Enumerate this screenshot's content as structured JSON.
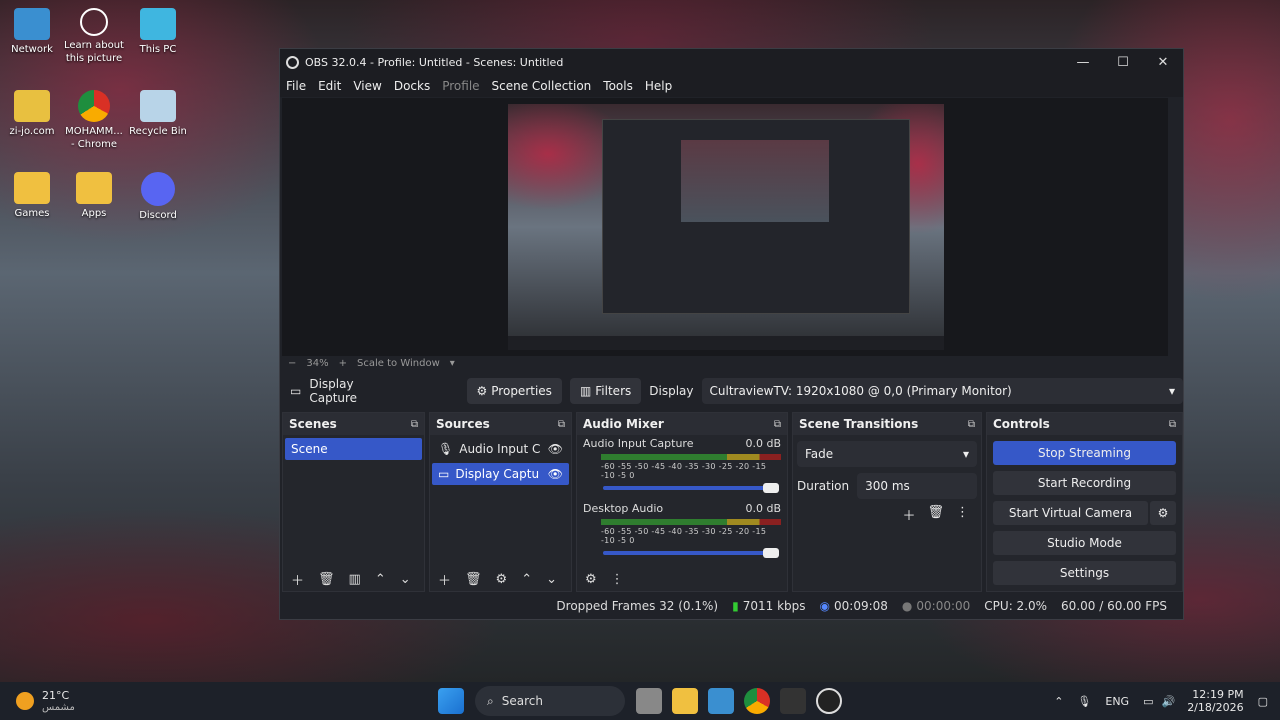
{
  "desktop": {
    "icons": [
      {
        "label": "Network"
      },
      {
        "label": "Learn about this picture"
      },
      {
        "label": "This PC"
      },
      {
        "label": "zi-jo.com"
      },
      {
        "label": "MOHAMM... - Chrome"
      },
      {
        "label": "Recycle Bin"
      },
      {
        "label": "Games"
      },
      {
        "label": "Apps"
      },
      {
        "label": "Discord"
      }
    ]
  },
  "window": {
    "title": "OBS 32.0.4 - Profile: Untitled - Scenes: Untitled",
    "minimize": "—",
    "maximize": "☐",
    "close": "✕"
  },
  "menu": [
    "File",
    "Edit",
    "View",
    "Docks",
    "Profile",
    "Scene Collection",
    "Tools",
    "Help"
  ],
  "zoom": {
    "minus": "−",
    "level": "34%",
    "plus": "+",
    "mode": "Scale to Window"
  },
  "source_bar": {
    "selected": "Display Capture",
    "properties": "Properties",
    "filters": "Filters",
    "display_label": "Display",
    "display_value": "CultraviewTV: 1920x1080 @ 0,0 (Primary Monitor)"
  },
  "scenes": {
    "title": "Scenes",
    "items": [
      "Scene"
    ]
  },
  "sources": {
    "title": "Sources",
    "items": [
      "Audio Input C",
      "Display Captu"
    ]
  },
  "mixer": {
    "title": "Audio Mixer",
    "channels": [
      {
        "name": "Audio Input Capture",
        "db": "0.0 dB"
      },
      {
        "name": "Desktop Audio",
        "db": "0.0 dB"
      }
    ],
    "scale": "-60 -55 -50 -45 -40 -35 -30 -25 -20 -15 -10 -5 0"
  },
  "transitions": {
    "title": "Scene Transitions",
    "selected": "Fade",
    "duration_label": "Duration",
    "duration_value": "300 ms"
  },
  "controls": {
    "title": "Controls",
    "stop_streaming": "Stop Streaming",
    "start_recording": "Start Recording",
    "start_virtual_camera": "Start Virtual Camera",
    "studio_mode": "Studio Mode",
    "settings": "Settings"
  },
  "status": {
    "dropped": "Dropped Frames 32 (0.1%)",
    "bitrate": "7011 kbps",
    "stream_time": "00:09:08",
    "rec_time": "00:00:00",
    "cpu": "CPU: 2.0%",
    "fps": "60.00 / 60.00 FPS"
  },
  "taskbar": {
    "weather_temp": "21°C",
    "weather_text": "مشمس",
    "search": "Search",
    "lang": "ENG",
    "time": "12:19 PM",
    "date": "2/18/2026"
  }
}
